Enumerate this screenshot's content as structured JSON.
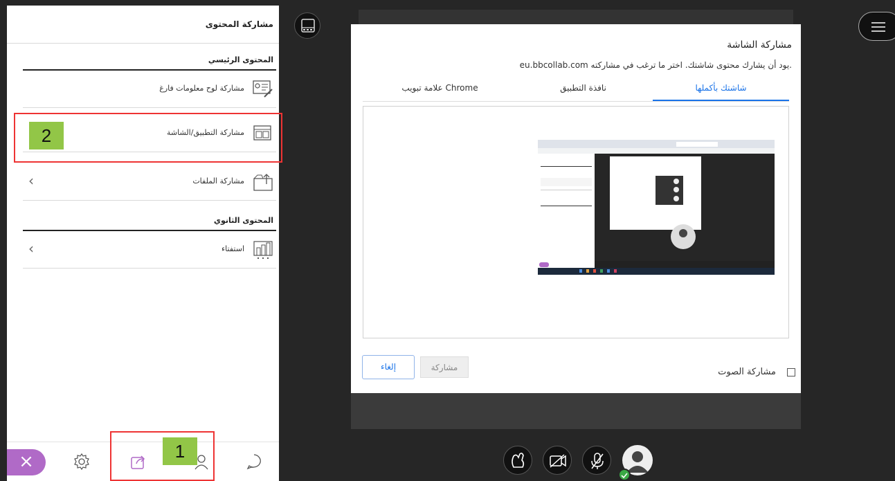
{
  "panel": {
    "title": "مشاركة المحتوى",
    "primary_section": "المحتوى الرئيسي",
    "secondary_section": "المحتوى الثانوي",
    "items": [
      {
        "label": "مشاركة لوح معلومات فارغ",
        "icon": "whiteboard-icon"
      },
      {
        "label": "مشاركة التطبيق/الشاشة",
        "icon": "screen-share-icon"
      },
      {
        "label": "مشاركة الملفات",
        "icon": "file-folder-icon"
      },
      {
        "label": "استفتاء",
        "icon": "poll-chart-icon"
      }
    ]
  },
  "annotations": {
    "badge_1": "1",
    "badge_2": "2"
  },
  "dialog": {
    "title": "مشاركة الشاشة",
    "description": ".يود أن يشارك محتوى شاشتك. اختر ما ترغب في مشاركته eu.bbcollab.com",
    "tabs": [
      {
        "label": "شاشتك بأكملها",
        "active": true
      },
      {
        "label": "نافذة التطبيق",
        "active": false
      },
      {
        "label": "علامة تبويب Chrome",
        "active": false
      }
    ],
    "audio_label": "مشاركة الصوت",
    "share_button": "مشاركة",
    "cancel_button": "إلغاء"
  },
  "colors": {
    "accent_blue": "#1a73e8",
    "close_purple": "#b06ac7",
    "annotation_red": "#e33333",
    "badge_green": "#92c647",
    "stage_bg": "#262626"
  }
}
